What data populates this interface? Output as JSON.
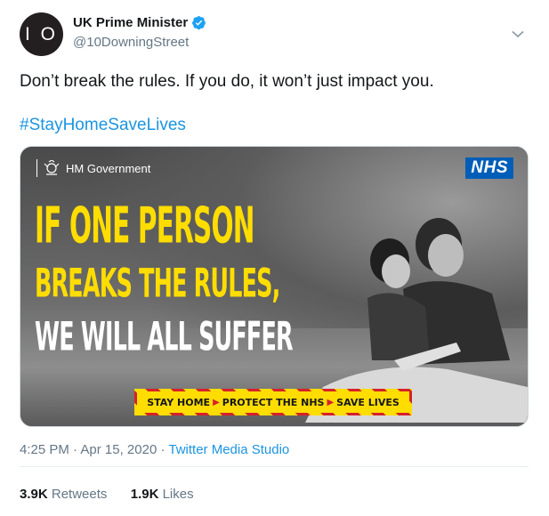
{
  "author": {
    "avatar_text": "I O",
    "name": "UK Prime Minister",
    "handle": "@10DowningStreet"
  },
  "tweet": {
    "text": "Don’t break the rules. If you do, it won’t just impact you.",
    "hashtag": "#StayHomeSaveLives"
  },
  "media": {
    "gov_label": "HM Government",
    "nhs_label": "NHS",
    "headline_1": "IF ONE PERSON",
    "headline_2": "BREAKS THE RULES,",
    "headline_3": "WE WILL ALL SUFFER",
    "strip_1": "STAY HOME",
    "strip_2": "PROTECT THE NHS",
    "strip_3": "SAVE LIVES",
    "colors": {
      "headline_yellow": "#ffdd00",
      "nhs_blue": "#005eb8",
      "strip_red": "#d6212a"
    }
  },
  "meta": {
    "time": "4:25 PM",
    "date": "Apr 15, 2020",
    "separator": "·",
    "source": "Twitter Media Studio"
  },
  "stats": {
    "retweets_count": "3.9K",
    "retweets_label": "Retweets",
    "likes_count": "1.9K",
    "likes_label": "Likes"
  },
  "icons": {
    "verified": "verified-badge-icon",
    "menu": "chevron-down-icon",
    "crest": "royal-crest-icon"
  },
  "colors": {
    "link": "#1b95e0",
    "secondary": "#657786",
    "text": "#14171a"
  }
}
